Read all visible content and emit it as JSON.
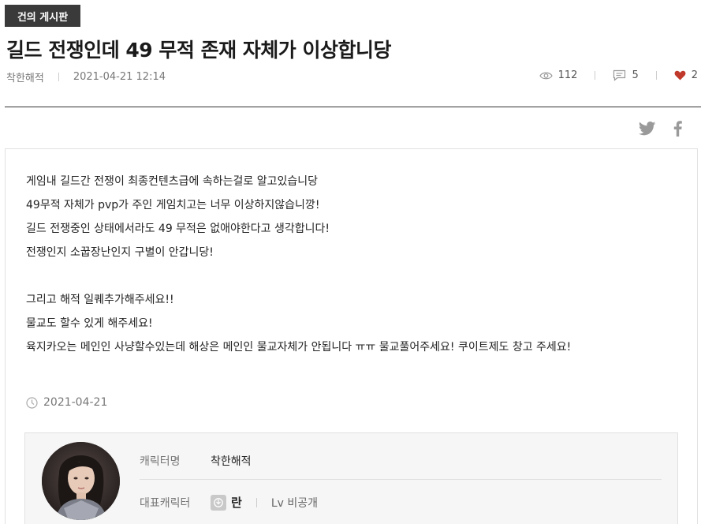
{
  "board": {
    "name": "건의 게시판"
  },
  "post": {
    "title": "길드 전쟁인데 49 무적 존재 자체가 이상합니당",
    "author": "착한해적",
    "datetime": "2021-04-21 12:14",
    "views": "112",
    "comments": "5",
    "likes": "2",
    "date": "2021-04-21",
    "lines": [
      "게임내 길드간 전쟁이 최종컨텐츠급에 속하는걸로 알고있습니당",
      "49무적 자체가 pvp가 주인 게임치고는 너무 이상하지않습니깡!",
      "길드 전쟁중인 상태에서라도 49 무적은 없애야한다고 생각합니다!",
      "전쟁인지 소꿉장난인지 구별이 안갑니당!",
      "",
      "그리고 해적 일퀘추가해주세요!!",
      "물교도 할수 있게 해주세요!",
      "육지카오는 메인인 사냥할수있는데 해상은 메인인 물교자체가 안됩니다 ㅠㅠ 물교풀어주세요! 쿠이트제도 창고 주세요!"
    ]
  },
  "character": {
    "name_label": "캐릭터명",
    "name": "착한해적",
    "rep_label": "대표캐릭터",
    "rep_name": "란",
    "level": "Lv 비공개"
  },
  "colors": {
    "heart": "#c0392b",
    "badge_bg": "#3a3a3a",
    "rule": "#333333"
  },
  "icons": [
    "eye-icon",
    "comment-icon",
    "heart-icon",
    "twitter-icon",
    "facebook-icon",
    "clock-icon",
    "server-icon"
  ]
}
